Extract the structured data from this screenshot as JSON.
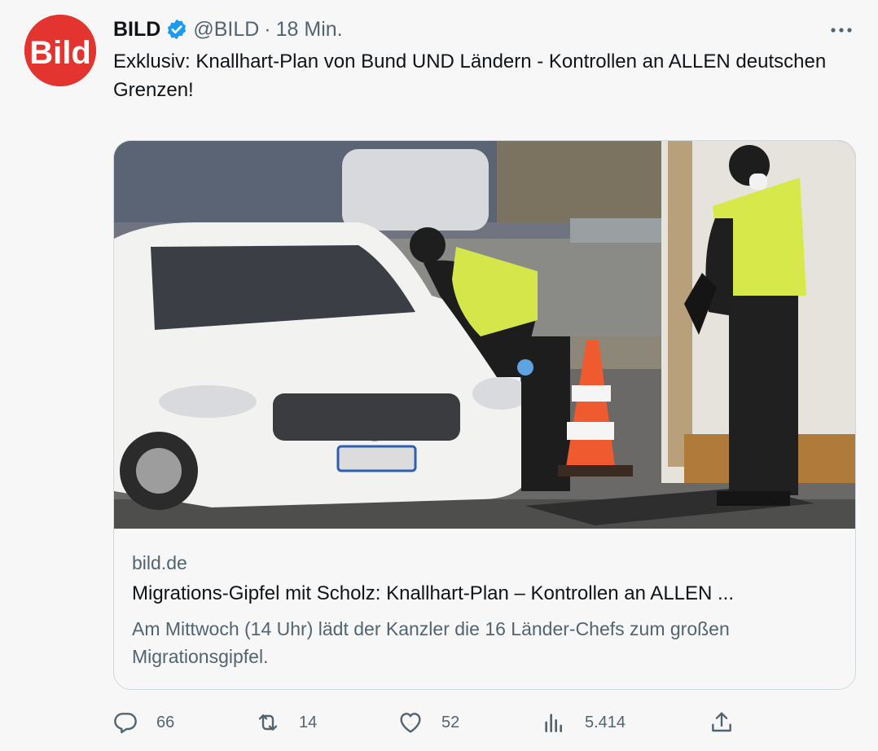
{
  "tweet": {
    "display_name": "BILD",
    "handle": "@BILD",
    "separator": "·",
    "time": "18 Min.",
    "text": "Exklusiv: Knallhart-Plan von Bund UND Ländern - Kontrollen an ALLEN deutschen Grenzen!",
    "avatar_logo": "Bild"
  },
  "card": {
    "domain": "bild.de",
    "title": "Migrations-Gipfel mit Scholz: Knallhart-Plan – Kontrollen an ALLEN ...",
    "description": "Am Mittwoch (14 Uhr) lädt der Kanzler die 16 Länder-Chefs zum großen Migrationsgipfel."
  },
  "actions": {
    "replies": "66",
    "retweets": "14",
    "likes": "52",
    "views": "5.414"
  },
  "icons": {
    "verified": "verified-badge-icon",
    "more": "more-icon",
    "reply": "reply-icon",
    "retweet": "retweet-icon",
    "like": "heart-icon",
    "views": "views-icon",
    "share": "share-icon"
  },
  "colors": {
    "brand_red": "#e3342f",
    "verified_blue": "#1d9bf0",
    "secondary_text": "#536471"
  }
}
